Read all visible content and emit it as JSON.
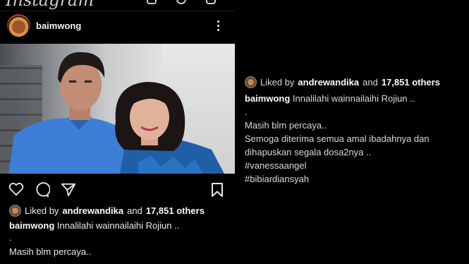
{
  "app": {
    "logo_text": "Instagram"
  },
  "post": {
    "username": "baimwong",
    "likes": {
      "liked_by_prefix": "Liked by",
      "liker": "andrewandika",
      "and_text": "and",
      "others": "17,851 others"
    },
    "caption_user": "baimwong",
    "caption_first_line": "Innalilahi wainnailaihi Rojiun ..",
    "caption_lines": [
      ".",
      "Masih blm percaya..",
      "Semoga diterima semua amal ibadahnya dan",
      "dihapuskan segala dosa2nya ..",
      "#vanessaangel",
      "#bibiardiansyah"
    ]
  },
  "icons": {
    "heart": "heart-icon",
    "comment": "comment-icon",
    "share": "send-icon",
    "save": "bookmark-icon",
    "more": "more-vertical-icon"
  },
  "colors": {
    "background": "#000000",
    "text": "#eaeaea"
  }
}
